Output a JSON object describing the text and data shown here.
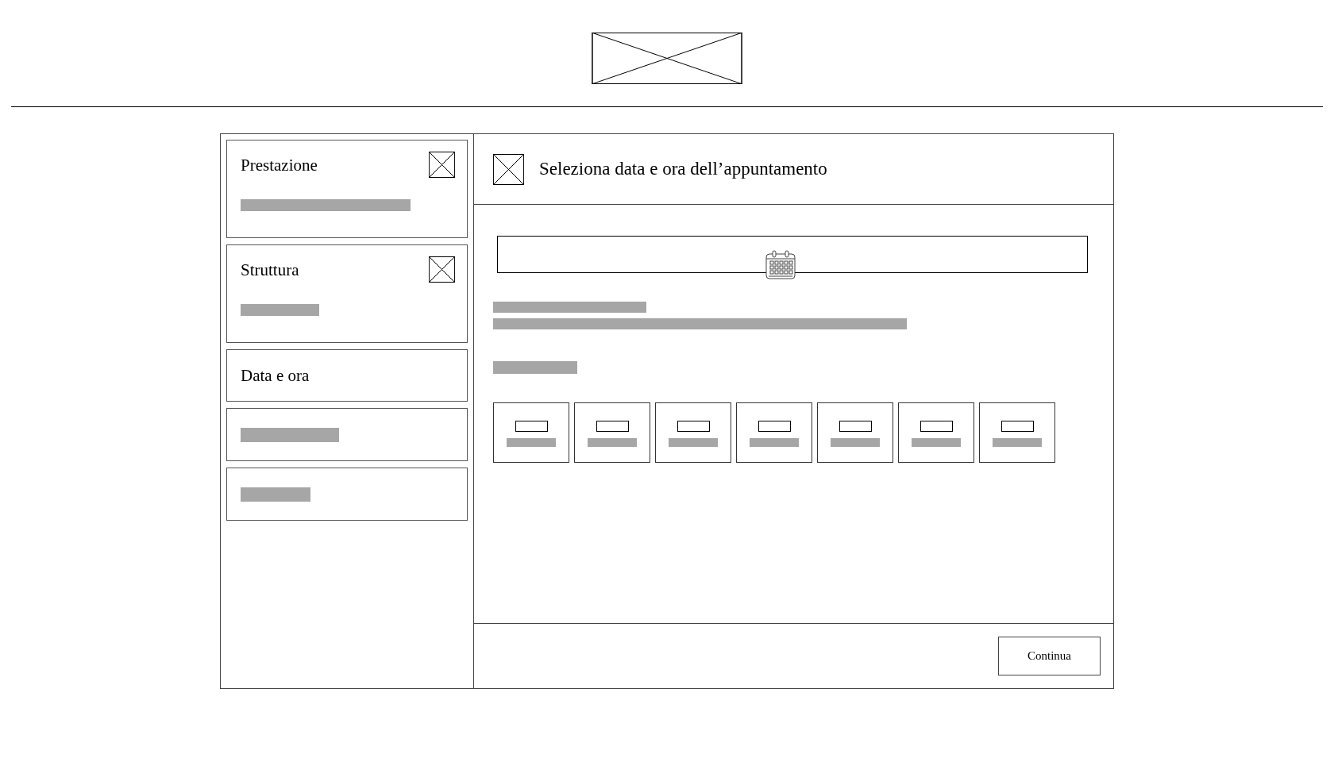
{
  "steps": [
    {
      "kind": "done",
      "label": "Prestazione"
    },
    {
      "kind": "done",
      "label": "Struttura"
    },
    {
      "kind": "current",
      "label": "Data e ora"
    },
    {
      "kind": "pending"
    },
    {
      "kind": "pending"
    }
  ],
  "panel": {
    "title": "Seleziona data e ora dell’appuntamento"
  },
  "day_slots": [
    {
      "kind": "day"
    },
    {
      "kind": "day"
    },
    {
      "kind": "day"
    },
    {
      "kind": "day"
    },
    {
      "kind": "day"
    },
    {
      "kind": "day"
    },
    {
      "kind": "day"
    }
  ],
  "footer": {
    "button": "Continua"
  }
}
